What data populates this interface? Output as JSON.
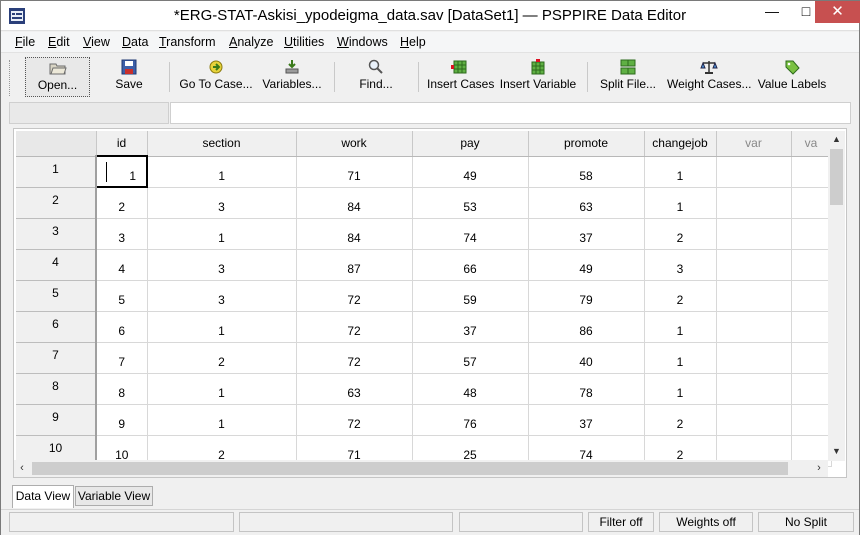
{
  "window": {
    "title": "*ERG-STAT-Askisi_ypodeigma_data.sav [DataSet1] — PSPPIRE Data Editor",
    "minimize": "—",
    "maximize": "□",
    "close": "✕"
  },
  "menu": {
    "file": {
      "mn": "F",
      "rest": "ile"
    },
    "edit": {
      "mn": "E",
      "rest": "dit"
    },
    "view": {
      "mn": "V",
      "rest": "iew"
    },
    "data": {
      "mn": "D",
      "rest": "ata"
    },
    "transform": {
      "mn": "T",
      "rest": "ransform"
    },
    "analyze": {
      "mn": "A",
      "rest": "nalyze"
    },
    "utilities": {
      "mn": "U",
      "rest": "tilities"
    },
    "windows": {
      "mn": "W",
      "rest": "indows"
    },
    "help": {
      "mn": "H",
      "rest": "elp"
    }
  },
  "toolbar": {
    "open": "Open...",
    "save": "Save",
    "goto": "Go To Case...",
    "variables": "Variables...",
    "find": "Find...",
    "insert_cases": "Insert Cases",
    "insert_variable": "Insert Variable",
    "split_file": "Split File...",
    "weight_cases": "Weight Cases...",
    "value_labels": "Value Labels"
  },
  "refbar": {
    "cell_ref": "",
    "value": ""
  },
  "grid": {
    "columns": [
      "id",
      "section",
      "work",
      "pay",
      "promote",
      "changejob",
      "var",
      "va"
    ],
    "rows": [
      {
        "num": "1",
        "cells": [
          "1",
          "1",
          "71",
          "49",
          "58",
          "1"
        ]
      },
      {
        "num": "2",
        "cells": [
          "2",
          "3",
          "84",
          "53",
          "63",
          "1"
        ]
      },
      {
        "num": "3",
        "cells": [
          "3",
          "1",
          "84",
          "74",
          "37",
          "2"
        ]
      },
      {
        "num": "4",
        "cells": [
          "4",
          "3",
          "87",
          "66",
          "49",
          "3"
        ]
      },
      {
        "num": "5",
        "cells": [
          "5",
          "3",
          "72",
          "59",
          "79",
          "2"
        ]
      },
      {
        "num": "6",
        "cells": [
          "6",
          "1",
          "72",
          "37",
          "86",
          "1"
        ]
      },
      {
        "num": "7",
        "cells": [
          "7",
          "2",
          "72",
          "57",
          "40",
          "1"
        ]
      },
      {
        "num": "8",
        "cells": [
          "8",
          "1",
          "63",
          "48",
          "78",
          "1"
        ]
      },
      {
        "num": "9",
        "cells": [
          "9",
          "1",
          "72",
          "76",
          "37",
          "2"
        ]
      },
      {
        "num": "10",
        "cells": [
          "10",
          "2",
          "71",
          "25",
          "74",
          "2"
        ]
      }
    ]
  },
  "tabs": {
    "data_view": "Data View",
    "variable_view": "Variable View"
  },
  "status": {
    "filter": "Filter off",
    "weights": "Weights off",
    "split": "No Split"
  },
  "colors": {
    "close_button": "#c75050",
    "grid_header": "#f0f0f0"
  }
}
